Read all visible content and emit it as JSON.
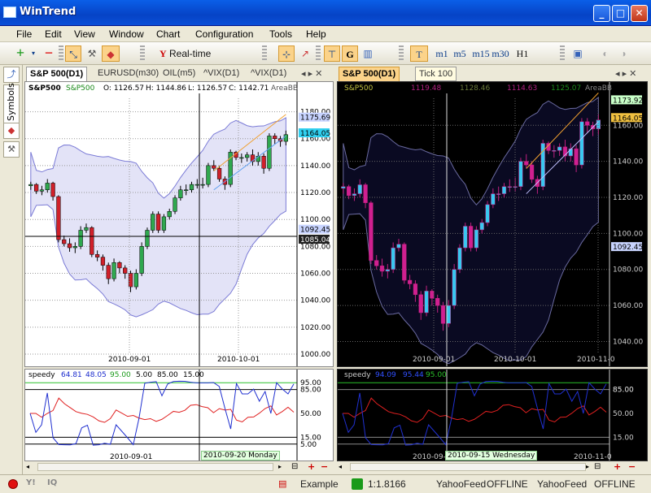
{
  "app": {
    "title": "WinTrend"
  },
  "menu": [
    "File",
    "Edit",
    "View",
    "Window",
    "Chart",
    "Configuration",
    "Tools",
    "Help"
  ],
  "toolbar": {
    "feed_mode": "Real-time",
    "timeframes": [
      "m1",
      "m5",
      "m15",
      "m30",
      "H1"
    ],
    "tick_label": "Tick 100"
  },
  "sidebar": {
    "symbols_label": "Symbols"
  },
  "left_chart": {
    "tabs": [
      "S&P 500(D1)",
      "EURUSD(m30)",
      "OIL(m5)",
      "^VIX(D1)",
      "^VIX(D1)"
    ],
    "header": {
      "symbol": "S&P500",
      "symbol2": "S&P500",
      "open": "O: 1126.57",
      "high": "H: 1144.86",
      "low": "L: 1126.57",
      "close": "C: 1142.71",
      "indicator": "AreaBB"
    },
    "price_ticks": [
      "1180.00",
      "1160.00",
      "1140.00",
      "1120.00",
      "1100.00",
      "1080.00",
      "1060.00",
      "1040.00",
      "1020.00",
      "1000.00"
    ],
    "price_tags": [
      "1175.69",
      "1164.05",
      "1092.45",
      "1085.04"
    ],
    "date_ticks": [
      "2010-09-01",
      "2010-10-01"
    ],
    "osc_header": {
      "name": "speedy",
      "v1": "64.81",
      "v2": "48.05",
      "v3": "95.00",
      "v4": "5.00",
      "v5": "85.00",
      "v6": "15.00"
    },
    "osc_ticks": [
      "95.00",
      "85.00",
      "50.00",
      "15.00",
      "5.00"
    ],
    "osc_date_ticks": [
      "2010-09-01"
    ],
    "cursor_date": "2010-09-20 Monday"
  },
  "right_chart": {
    "tab": "S&P 500(D1)",
    "header": {
      "symbol": "S&P500",
      "open": "1119.48",
      "high": "1128.46",
      "low": "1114.63",
      "close": "1125.07",
      "indicator": "AreaBB"
    },
    "price_ticks": [
      "1160.00",
      "1140.00",
      "1120.00",
      "1100.00",
      "1080.00",
      "1060.00",
      "1040.00"
    ],
    "price_tags": [
      "1173.92",
      "1164.05",
      "1092.45"
    ],
    "date_ticks": [
      "2010-09-01",
      "2010-10-01",
      "2010-11-0"
    ],
    "osc_header": {
      "name": "speedy",
      "v1": "94.09",
      "v2": "95.44",
      "v3": "95.00"
    },
    "osc_ticks": [
      "85.00",
      "85.00",
      "50.00",
      "15.00"
    ],
    "osc_date_ticks": [
      "2010-09-0",
      "2010-11-0"
    ],
    "cursor_date": "2010-09-15 Wednesday"
  },
  "status": {
    "example": "Example",
    "ratio": "1:1.8166",
    "feed1": "YahooFeed",
    "state1": "OFFLINE",
    "feed2": "YahooFeed",
    "state2": "OFFLINE"
  },
  "chart_data": [
    {
      "type": "candlestick",
      "title": "S&P500 (D1)",
      "ylim": [
        1000,
        1190
      ],
      "x": [
        "2010-08-04",
        "2010-08-05",
        "2010-08-06",
        "2010-08-09",
        "2010-08-10",
        "2010-08-11",
        "2010-08-12",
        "2010-08-13",
        "2010-08-16",
        "2010-08-17",
        "2010-08-18",
        "2010-08-19",
        "2010-08-20",
        "2010-08-23",
        "2010-08-24",
        "2010-08-25",
        "2010-08-26",
        "2010-08-27",
        "2010-08-30",
        "2010-08-31",
        "2010-09-01",
        "2010-09-02",
        "2010-09-03",
        "2010-09-07",
        "2010-09-08",
        "2010-09-09",
        "2010-09-10",
        "2010-09-13",
        "2010-09-14",
        "2010-09-15",
        "2010-09-16",
        "2010-09-17",
        "2010-09-20",
        "2010-09-21",
        "2010-09-22",
        "2010-09-23",
        "2010-09-24",
        "2010-09-27",
        "2010-09-28",
        "2010-09-29",
        "2010-09-30",
        "2010-10-01",
        "2010-10-04",
        "2010-10-05",
        "2010-10-06",
        "2010-10-07",
        "2010-10-08"
      ],
      "open": [
        1125,
        1126,
        1121,
        1122,
        1127,
        1117,
        1085,
        1082,
        1079,
        1080,
        1092,
        1094,
        1074,
        1072,
        1066,
        1056,
        1068,
        1064,
        1060,
        1050,
        1060,
        1080,
        1092,
        1104,
        1092,
        1102,
        1106,
        1116,
        1122,
        1122,
        1126,
        1126,
        1126,
        1140,
        1138,
        1130,
        1126,
        1150,
        1146,
        1146,
        1148,
        1143,
        1147,
        1138,
        1162,
        1160,
        1158
      ],
      "close": [
        1126,
        1121,
        1122,
        1127,
        1117,
        1085,
        1082,
        1079,
        1080,
        1092,
        1094,
        1074,
        1072,
        1066,
        1056,
        1068,
        1064,
        1060,
        1050,
        1060,
        1080,
        1092,
        1104,
        1092,
        1102,
        1106,
        1116,
        1122,
        1122,
        1126,
        1126,
        1126,
        1140,
        1138,
        1130,
        1126,
        1150,
        1146,
        1146,
        1148,
        1143,
        1147,
        1138,
        1162,
        1160,
        1158,
        1163
      ],
      "high": [
        1128,
        1127,
        1125,
        1130,
        1128,
        1118,
        1088,
        1086,
        1083,
        1095,
        1097,
        1095,
        1077,
        1074,
        1068,
        1071,
        1069,
        1066,
        1062,
        1063,
        1083,
        1094,
        1106,
        1106,
        1104,
        1108,
        1118,
        1125,
        1126,
        1128,
        1130,
        1131,
        1142,
        1144,
        1140,
        1132,
        1152,
        1151,
        1149,
        1150,
        1152,
        1150,
        1149,
        1164,
        1164,
        1162,
        1166
      ],
      "low": [
        1122,
        1119,
        1118,
        1120,
        1114,
        1083,
        1080,
        1076,
        1075,
        1078,
        1090,
        1072,
        1069,
        1062,
        1052,
        1054,
        1060,
        1056,
        1046,
        1048,
        1058,
        1078,
        1090,
        1090,
        1090,
        1100,
        1104,
        1114,
        1118,
        1120,
        1123,
        1123,
        1124,
        1136,
        1128,
        1122,
        1124,
        1144,
        1142,
        1143,
        1140,
        1140,
        1134,
        1136,
        1156,
        1154,
        1155
      ]
    }
  ]
}
